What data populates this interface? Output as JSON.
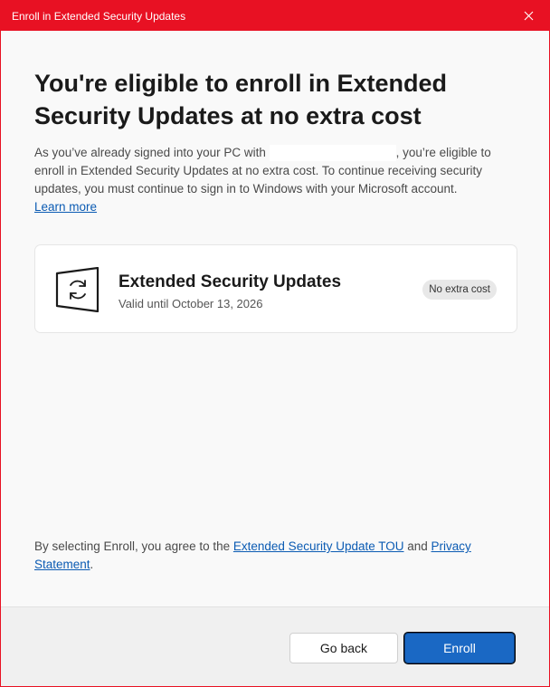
{
  "window": {
    "title": "Enroll in Extended Security Updates",
    "accent_color": "#e81123"
  },
  "main": {
    "heading": "You're eligible to enroll in Extended Security Updates at no extra cost",
    "desc_before": "As you’ve already signed into your PC with ",
    "desc_after": ", you’re eligible to enroll in Extended Security Updates at no extra cost. To continue receiving security updates, you must continue to sign in to Windows with your Microsoft account.",
    "learn_more": "Learn more"
  },
  "card": {
    "icon": "windows-update-icon",
    "title": "Extended Security Updates",
    "subtitle": "Valid until October 13, 2026",
    "badge": "No extra cost"
  },
  "agreement": {
    "before": "By selecting Enroll, you agree to the ",
    "tou_link": "Extended Security Update TOU",
    "middle": " and ",
    "privacy_link": "Privacy Statement",
    "after": "."
  },
  "footer": {
    "back_label": "Go back",
    "enroll_label": "Enroll",
    "primary_color": "#1a68c4"
  }
}
